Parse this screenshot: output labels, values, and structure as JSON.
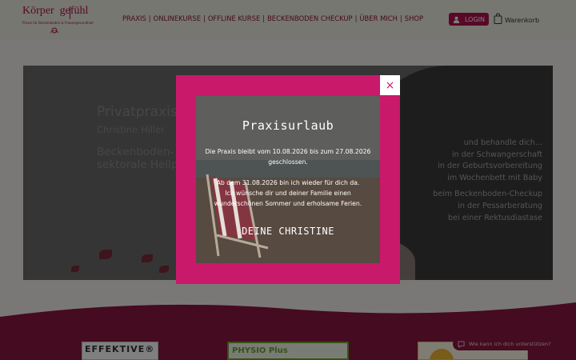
{
  "header": {
    "logo": {
      "word_left": "Körper",
      "word_right": "gefühl",
      "tagline": "Praxis für Beckenboden & Frauengesundheit"
    },
    "nav": [
      "PRAXIS",
      "ONLINEKURSE",
      "OFFLINE KURSE",
      "BECKENBODEN CHECKUP",
      "ÜBER MICH",
      "SHOP"
    ],
    "nav_separator": "|",
    "login_label": "LOGIN",
    "cart_label": "Warenkorb"
  },
  "hero": {
    "title": "Privatpraxis",
    "subtitle": "Christine Hiller",
    "description": [
      "Beckenboden-",
      "sektorale Heilp"
    ],
    "services_heading": "und behandle dich...",
    "services": [
      "in der Schwangerschaft",
      "in der Geburtsvorbereitung",
      "im Wochenbett mit Baby",
      "",
      "beim Beckenboden-Checkup",
      "in der Pessarberatung",
      "bei einer Rektusdiastase"
    ]
  },
  "partners": {
    "card1_label": "EFFEKTIVE®",
    "card2_label": "PHYSIO  Plus"
  },
  "chat": {
    "label": "Wie kann ich dich unterstützen?"
  },
  "modal": {
    "title": "Praxisurlaub",
    "line1": "Die Praxis bleibt vom 10.08.2026 bis zum 27.08.2026",
    "line2": "geschlossen.",
    "line3": "Ab dem 31.08.2026 bin ich wieder für dich da.",
    "line4": "Ich wünsche dir und deiner Familie einen",
    "line5": "wunderschönen Sommer und erholsame Ferien.",
    "signature": "DEINE CHRISTINE",
    "close_label": "×"
  },
  "colors": {
    "brand": "#b0124f",
    "modal_frame": "#c9196a",
    "section_bg": "#8b1740",
    "header_bg": "#eceee0"
  }
}
